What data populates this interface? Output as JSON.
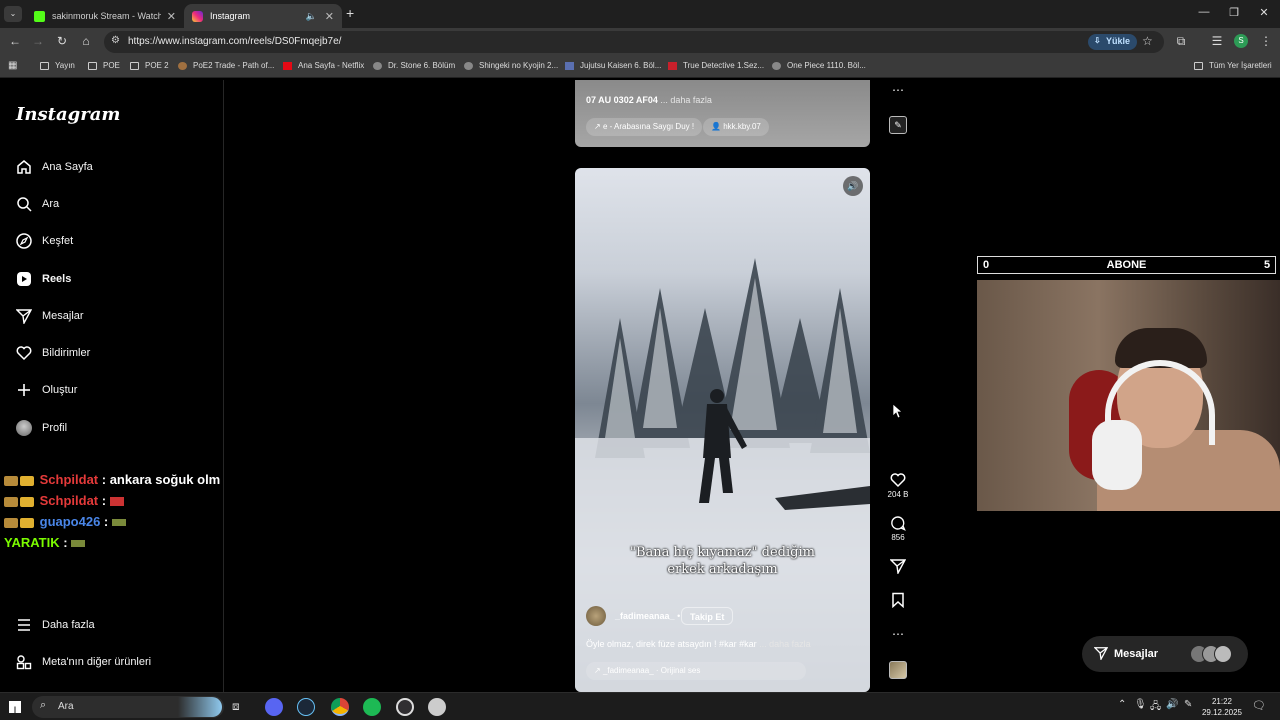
{
  "browser": {
    "tabs": [
      {
        "title": "sakinmoruk Stream - Watch Liv",
        "active": false,
        "favicon_color": "#53fc18"
      },
      {
        "title": "Instagram",
        "active": true,
        "favicon_color": "#e1306c"
      }
    ],
    "url": "https://www.instagram.com/reels/DS0Fmqejb7e/",
    "yukle_label": "Yükle",
    "profile_initial": "S",
    "bookmarks": [
      {
        "label": "Yayın",
        "icon": "folder-icon"
      },
      {
        "label": "POE",
        "icon": "folder-icon"
      },
      {
        "label": "POE 2",
        "icon": "folder-icon"
      },
      {
        "label": "PoE2 Trade - Path of...",
        "icon": "poe-icon"
      },
      {
        "label": "Ana Sayfa - Netflix",
        "icon": "netflix-icon"
      },
      {
        "label": "Dr. Stone 6. Bölüm",
        "icon": "site-icon"
      },
      {
        "label": "Shingeki no Kyojin 2...",
        "icon": "site-icon"
      },
      {
        "label": "Jujutsu Kaisen 6. Böl...",
        "icon": "site-icon"
      },
      {
        "label": "True Detective 1.Sez...",
        "icon": "site-icon"
      },
      {
        "label": "One Piece 1110. Böl...",
        "icon": "site-icon"
      }
    ],
    "all_bookmarks_label": "Tüm Yer İşaretleri"
  },
  "sidebar": {
    "logo": "Instagram",
    "items": [
      {
        "label": "Ana Sayfa",
        "icon": "home-icon"
      },
      {
        "label": "Ara",
        "icon": "search-icon"
      },
      {
        "label": "Keşfet",
        "icon": "compass-icon"
      },
      {
        "label": "Reels",
        "icon": "reels-icon",
        "active": true
      },
      {
        "label": "Mesajlar",
        "icon": "send-icon"
      },
      {
        "label": "Bildirimler",
        "icon": "heart-icon"
      },
      {
        "label": "Oluştur",
        "icon": "plus-icon"
      },
      {
        "label": "Profil",
        "icon": "avatar-icon"
      }
    ],
    "more_label": "Daha fazla",
    "meta_label": "Meta'nın diğer ürünleri"
  },
  "chat": [
    {
      "user": "Schpildat",
      "message": "ankara soğuk olm",
      "color": "#e53a3a"
    },
    {
      "user": "Schpildat",
      "message": "",
      "color": "#e53a3a"
    },
    {
      "user": "guapo426",
      "message": "",
      "color": "#4a86e8"
    },
    {
      "user": "YARATIK",
      "message": "",
      "color": "#7cfc00"
    }
  ],
  "prev_reel": {
    "caption": "07 AU 0302 AF04",
    "more": "... daha fazla",
    "audio": "e - Arabasına Saygı Duy !",
    "tag": "hkk.kby.07"
  },
  "reel": {
    "subtitle_line1": "\"Bana hiç kıyamaz\" dediğim",
    "subtitle_line2": "erkek arkadaşım",
    "username": "_fadimeanaa_",
    "follow": "Takip Et",
    "caption": "Öyle olmaz, direk füze atsaydın ! #kar #kar",
    "more": "... daha fazla",
    "audio": "_fadimeanaa_ · Orijinal ses",
    "likes": "204 B",
    "comments": "856"
  },
  "stream_overlay": {
    "left_value": "0",
    "label": "ABONE",
    "right_value": "5"
  },
  "messages_pill": {
    "label": "Mesajlar"
  },
  "taskbar": {
    "search_label": "Ara",
    "time": "21:22",
    "date": "29.12.2025"
  },
  "colors": {
    "instagram_bg": "#000000",
    "accent_blue": "#0095f6"
  }
}
